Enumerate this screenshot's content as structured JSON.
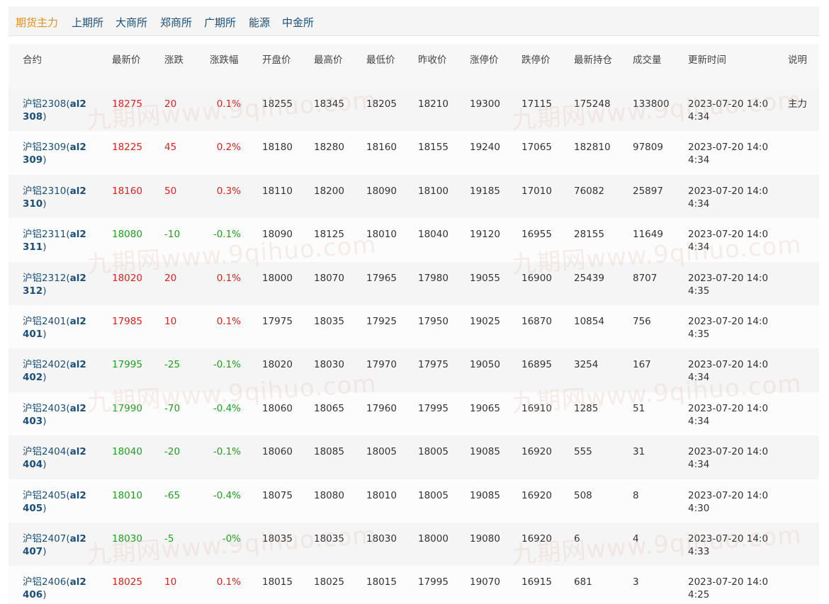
{
  "tabs": [
    {
      "label": "期货主力",
      "active": true
    },
    {
      "label": "上期所",
      "active": false
    },
    {
      "label": "大商所",
      "active": false
    },
    {
      "label": "郑商所",
      "active": false
    },
    {
      "label": "广期所",
      "active": false
    },
    {
      "label": "能源",
      "active": false
    },
    {
      "label": "中金所",
      "active": false
    }
  ],
  "colors": {
    "accent": "#f08d15",
    "link": "#1b4f7a",
    "up": "#e02020",
    "down": "#1f9d20"
  },
  "watermark": "九期网www.9qihuo.com",
  "columns": [
    "合约",
    "最新价",
    "涨跌",
    "涨跌幅",
    "开盘价",
    "最高价",
    "最低价",
    "昨收价",
    "涨停价",
    "跌停价",
    "最新持仓",
    "成交量",
    "更新时间",
    "说明"
  ],
  "rows": [
    {
      "name": "沪铝2308",
      "code": "al2308",
      "last": "18275",
      "change": "20",
      "pct": "0.1%",
      "dir": "up",
      "open": "18255",
      "high": "18345",
      "low": "18205",
      "prev": "18210",
      "limit_up": "19300",
      "limit_down": "17115",
      "oi": "175248",
      "volume": "133800",
      "time": "2023-07-20 14:04:34",
      "note": "主力"
    },
    {
      "name": "沪铝2309",
      "code": "al2309",
      "last": "18225",
      "change": "45",
      "pct": "0.2%",
      "dir": "up",
      "open": "18180",
      "high": "18280",
      "low": "18160",
      "prev": "18155",
      "limit_up": "19240",
      "limit_down": "17065",
      "oi": "182810",
      "volume": "97809",
      "time": "2023-07-20 14:04:34",
      "note": ""
    },
    {
      "name": "沪铝2310",
      "code": "al2310",
      "last": "18160",
      "change": "50",
      "pct": "0.3%",
      "dir": "up",
      "open": "18110",
      "high": "18200",
      "low": "18090",
      "prev": "18100",
      "limit_up": "19185",
      "limit_down": "17010",
      "oi": "76082",
      "volume": "25897",
      "time": "2023-07-20 14:04:34",
      "note": ""
    },
    {
      "name": "沪铝2311",
      "code": "al2311",
      "last": "18080",
      "change": "-10",
      "pct": "-0.1%",
      "dir": "down",
      "open": "18090",
      "high": "18125",
      "low": "18010",
      "prev": "18040",
      "limit_up": "19120",
      "limit_down": "16955",
      "oi": "28155",
      "volume": "11649",
      "time": "2023-07-20 14:04:34",
      "note": ""
    },
    {
      "name": "沪铝2312",
      "code": "al2312",
      "last": "18020",
      "change": "20",
      "pct": "0.1%",
      "dir": "up",
      "open": "18000",
      "high": "18070",
      "low": "17965",
      "prev": "17980",
      "limit_up": "19055",
      "limit_down": "16900",
      "oi": "25439",
      "volume": "8707",
      "time": "2023-07-20 14:04:35",
      "note": ""
    },
    {
      "name": "沪铝2401",
      "code": "al2401",
      "last": "17985",
      "change": "10",
      "pct": "0.1%",
      "dir": "up",
      "open": "17975",
      "high": "18035",
      "low": "17925",
      "prev": "17950",
      "limit_up": "19025",
      "limit_down": "16870",
      "oi": "10854",
      "volume": "756",
      "time": "2023-07-20 14:04:35",
      "note": ""
    },
    {
      "name": "沪铝2402",
      "code": "al2402",
      "last": "17995",
      "change": "-25",
      "pct": "-0.1%",
      "dir": "down",
      "open": "18020",
      "high": "18030",
      "low": "17970",
      "prev": "17975",
      "limit_up": "19050",
      "limit_down": "16895",
      "oi": "3254",
      "volume": "167",
      "time": "2023-07-20 14:04:34",
      "note": ""
    },
    {
      "name": "沪铝2403",
      "code": "al2403",
      "last": "17990",
      "change": "-70",
      "pct": "-0.4%",
      "dir": "down",
      "open": "18060",
      "high": "18065",
      "low": "17960",
      "prev": "17995",
      "limit_up": "19065",
      "limit_down": "16910",
      "oi": "1285",
      "volume": "51",
      "time": "2023-07-20 14:04:34",
      "note": ""
    },
    {
      "name": "沪铝2404",
      "code": "al2404",
      "last": "18040",
      "change": "-20",
      "pct": "-0.1%",
      "dir": "down",
      "open": "18060",
      "high": "18085",
      "low": "18005",
      "prev": "18005",
      "limit_up": "19085",
      "limit_down": "16920",
      "oi": "555",
      "volume": "31",
      "time": "2023-07-20 14:04:34",
      "note": ""
    },
    {
      "name": "沪铝2405",
      "code": "al2405",
      "last": "18010",
      "change": "-65",
      "pct": "-0.4%",
      "dir": "down",
      "open": "18075",
      "high": "18080",
      "low": "18010",
      "prev": "18005",
      "limit_up": "19085",
      "limit_down": "16920",
      "oi": "508",
      "volume": "8",
      "time": "2023-07-20 14:04:30",
      "note": ""
    },
    {
      "name": "沪铝2407",
      "code": "al2407",
      "last": "18030",
      "change": "-5",
      "pct": "-0%",
      "dir": "down",
      "open": "18035",
      "high": "18035",
      "low": "18030",
      "prev": "18000",
      "limit_up": "19080",
      "limit_down": "16920",
      "oi": "6",
      "volume": "4",
      "time": "2023-07-20 14:04:33",
      "note": ""
    },
    {
      "name": "沪铝2406",
      "code": "al2406",
      "last": "18025",
      "change": "10",
      "pct": "0.1%",
      "dir": "up",
      "open": "18015",
      "high": "18025",
      "low": "18015",
      "prev": "17995",
      "limit_up": "19070",
      "limit_down": "16915",
      "oi": "681",
      "volume": "3",
      "time": "2023-07-20 14:04:25",
      "note": ""
    }
  ]
}
